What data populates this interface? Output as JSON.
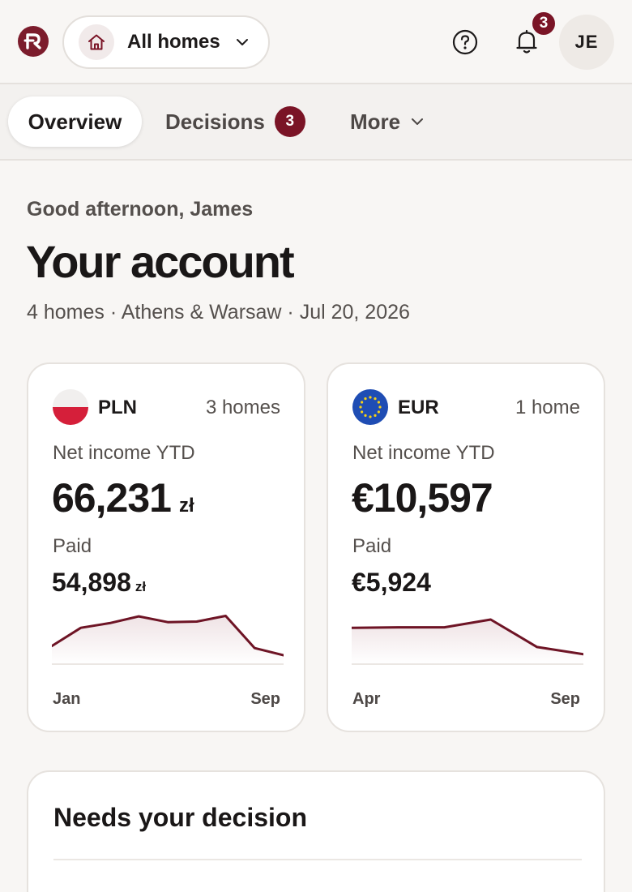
{
  "topbar": {
    "home_selector_label": "All homes",
    "notifications_count": "3",
    "avatar_initials": "JE"
  },
  "tabs": {
    "overview": "Overview",
    "decisions": "Decisions",
    "decisions_count": "3",
    "more": "More"
  },
  "greeting": "Good afternoon, James",
  "page_title": "Your account",
  "subtitle": "4 homes · Athens & Warsaw · Jul 20, 2026",
  "cards": [
    {
      "currency": "PLN",
      "homes": "3 homes",
      "net_label": "Net income YTD",
      "net_value": "66,231",
      "net_unit": "zł",
      "paid_label": "Paid",
      "paid_value": "54,898",
      "paid_unit": "zł",
      "axis_start": "Jan",
      "axis_end": "Sep",
      "trend": [
        35,
        70,
        79,
        92,
        81,
        82,
        93,
        31,
        17
      ]
    },
    {
      "currency": "EUR",
      "homes": "1 home",
      "net_label": "Net income YTD",
      "net_value": "€10,597",
      "paid_label": "Paid",
      "paid_value": "€5,924",
      "axis_start": "Apr",
      "axis_end": "Sep",
      "trend": [
        70,
        71,
        71,
        86,
        33,
        19
      ]
    }
  ],
  "decision_section": {
    "title": "Needs your decision"
  },
  "colors": {
    "accent": "#7a1426",
    "line": "#6e1425",
    "background": "#f8f6f4",
    "card": "#ffffff"
  }
}
